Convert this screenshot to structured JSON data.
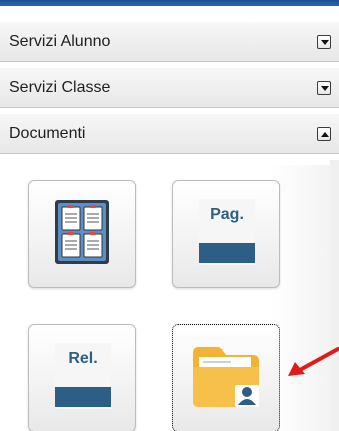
{
  "sections": [
    {
      "label": "Servizi Alunno",
      "state": "collapsed"
    },
    {
      "label": "Servizi Classe",
      "state": "collapsed"
    },
    {
      "label": "Documenti",
      "state": "expanded"
    }
  ],
  "documents": {
    "tiles": [
      {
        "icon": "grid-documents-icon"
      },
      {
        "label": "Pag.",
        "icon": "pag-document-icon"
      },
      {
        "label": "Rel.",
        "icon": "rel-document-icon"
      },
      {
        "icon": "user-folder-icon",
        "selected": true
      }
    ]
  },
  "colors": {
    "header_blue": "#2a66b0",
    "tile_dark_blue": "#2d5f86",
    "folder_orange": "#f2b233",
    "arrow_red": "#e01b1b"
  }
}
